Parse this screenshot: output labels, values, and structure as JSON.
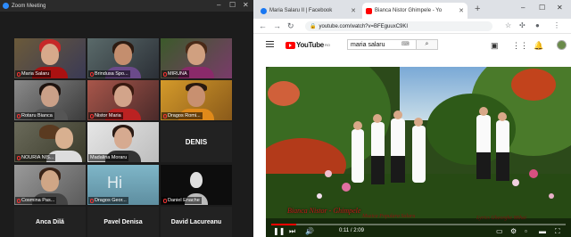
{
  "zoom": {
    "window_title": "Zoom Meeting",
    "participants": [
      {
        "name": "Maria Salaru",
        "muted": true
      },
      {
        "name": "Brindusa Spo...",
        "muted": true
      },
      {
        "name": "MIRUNA",
        "muted": true
      },
      {
        "name": "Rotaru Bianca",
        "muted": true
      },
      {
        "name": "Nistor Maria",
        "muted": true
      },
      {
        "name": "Dragos Romi...",
        "muted": true
      },
      {
        "name": "NOURIA NIS...",
        "muted": true
      },
      {
        "name": "Madalina Moraru",
        "muted": false
      },
      {
        "name": "DENIS",
        "muted": true
      },
      {
        "name": "Cosmina Pas...",
        "muted": true
      },
      {
        "name": "Dragos Geor...",
        "muted": true
      },
      {
        "name": "Daniel Enache",
        "muted": true
      },
      {
        "name": "Anca Dilă",
        "muted": true
      },
      {
        "name": "Pavel Denisa",
        "muted": true
      },
      {
        "name": "David Lacureanu",
        "muted": true
      }
    ],
    "tile_overlay_text": "Hi"
  },
  "chrome": {
    "tabs": [
      {
        "title": "Maria Salaru II | Facebook",
        "favicon": "facebook-icon",
        "color": "#1877f2"
      },
      {
        "title": "Bianca Nistor Ghimpele - Yo",
        "favicon": "youtube-icon",
        "color": "#ff0000"
      }
    ],
    "url": "youtube.com/watch?v=BFEguuxC9KI"
  },
  "youtube": {
    "logo_text": "YouTube",
    "region": "RO",
    "search_value": "maria salaru",
    "search_button_icon": "search-icon",
    "captions": {
      "title": "Bianca Nistor - Ghimpele",
      "left": "Muzica Populara Salaru",
      "right": "Lyrics Gheorghe Mihai"
    },
    "player": {
      "time": "0:11 / 2:09",
      "progress": 0.085
    }
  }
}
